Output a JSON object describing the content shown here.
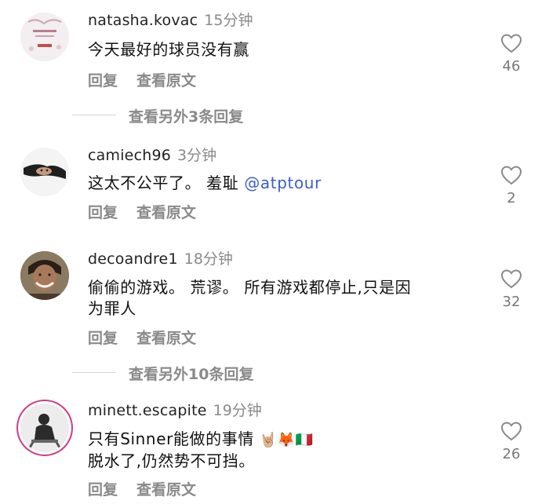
{
  "comments": [
    {
      "username": "natasha.kovac",
      "time": "15分钟",
      "text": "今天最好的球员没有赢",
      "reply_label": "回复",
      "translate_label": "查看原文",
      "likes": "46",
      "avatar_icon": "poster-avatar"
    },
    {
      "username": "camiech96",
      "time": "3分钟",
      "text": "这太不公平了。 羞耻 ",
      "mention": "@atptour",
      "reply_label": "回复",
      "translate_label": "查看原文",
      "likes": "2",
      "avatar_icon": "person-avatar"
    },
    {
      "username": "decoandre1",
      "time": "18分钟",
      "text_line1": "偷偷的游戏。 荒谬。 所有游戏都停止,只是因",
      "text_line2": "为罪人",
      "reply_label": "回复",
      "translate_label": "查看原文",
      "likes": "32",
      "avatar_icon": "person-avatar"
    },
    {
      "username": "minett.escapite",
      "time": "19分钟",
      "text_line1": "只有Sinner能做的事情 ",
      "emojis": "🤘🏼🦊🇮🇹",
      "text_line2": "脱水了,仍然势不可挡。",
      "reply_label": "回复",
      "translate_label": "查看原文",
      "likes": "26",
      "avatar_icon": "person-avatar-story-ring"
    }
  ],
  "more_replies": [
    {
      "label": "查看另外3条回复"
    },
    {
      "label": "查看另外10条回复"
    }
  ]
}
